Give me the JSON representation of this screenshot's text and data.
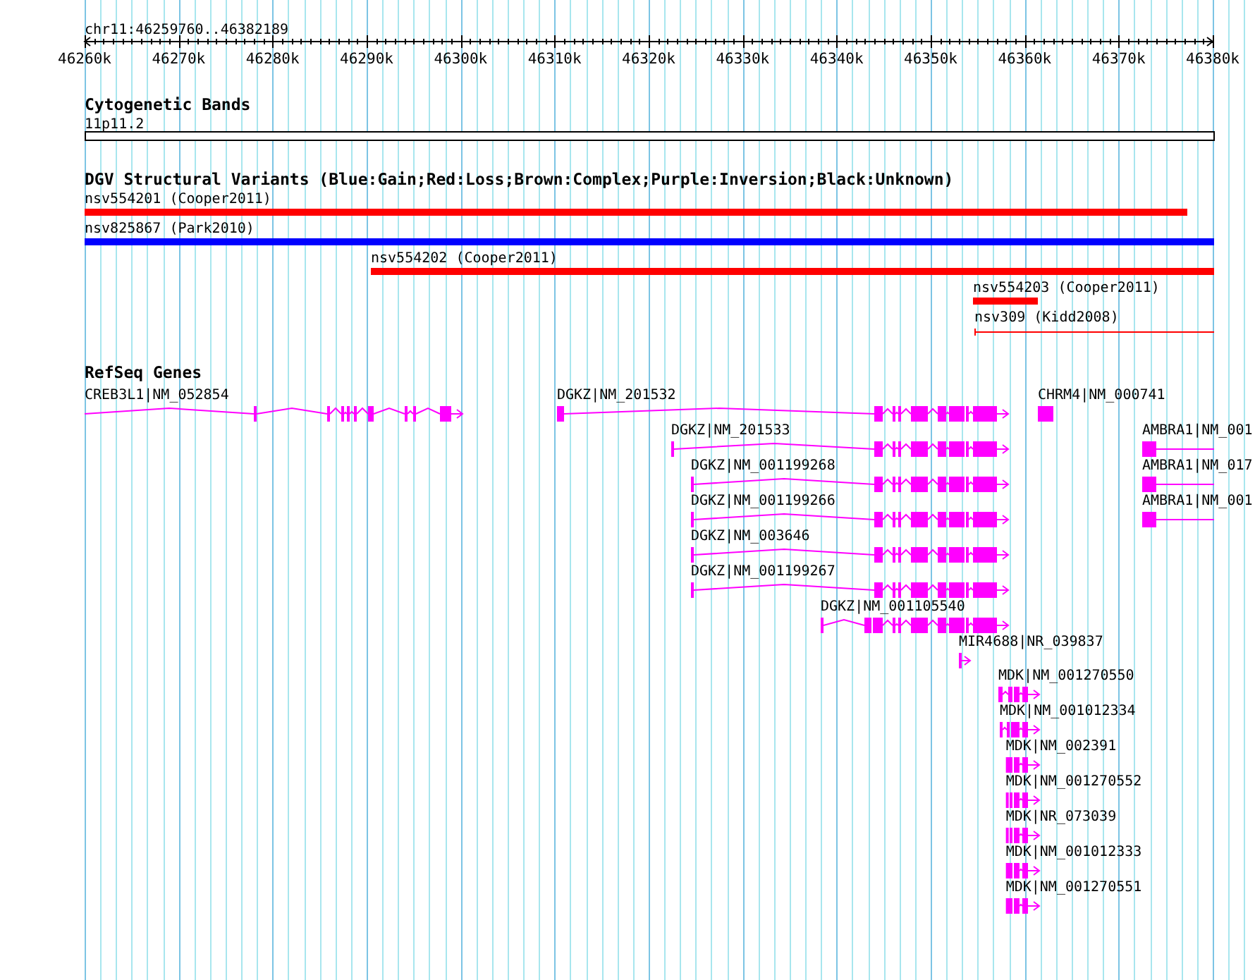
{
  "ruler": {
    "region": "chr11:46259760..46382189",
    "ticks": [
      "46260k",
      "46270k",
      "46280k",
      "46290k",
      "46300k",
      "46310k",
      "46320k",
      "46330k",
      "46340k",
      "46350k",
      "46360k",
      "46370k",
      "46380k"
    ]
  },
  "cytoband": {
    "title": "Cytogenetic Bands",
    "band": "11p11.2"
  },
  "dgv": {
    "title": "DGV Structural Variants (Blue:Gain;Red:Loss;Brown:Complex;Purple:Inversion;Black:Unknown)",
    "features": [
      {
        "label": "nsv554201 (Cooper2011)",
        "kind": "bar",
        "color": "#ff0000"
      },
      {
        "label": "nsv825867 (Park2010)",
        "kind": "bar",
        "color": "#0000ff"
      },
      {
        "label": "nsv554202 (Cooper2011)",
        "kind": "bar",
        "color": "#ff0000"
      },
      {
        "label": "nsv554203 (Cooper2011)",
        "kind": "bar",
        "color": "#ff0000"
      },
      {
        "label": "nsv309 (Kidd2008)",
        "kind": "line",
        "color": "#ff0000"
      }
    ]
  },
  "refseq": {
    "title": "RefSeq Genes",
    "rows": [
      {
        "genes": [
          {
            "label": "CREB3L1|NM_052854",
            "arrow": true
          },
          {
            "label": "DGKZ|NM_201532",
            "arrow": true
          },
          {
            "label": "CHRM4|NM_000741",
            "arrow": false
          }
        ]
      },
      {
        "genes": [
          {
            "label": "DGKZ|NM_201533",
            "arrow": true
          },
          {
            "label": "AMBRA1|NM_001",
            "arrow": false
          }
        ]
      },
      {
        "genes": [
          {
            "label": "DGKZ|NM_001199268",
            "arrow": true
          },
          {
            "label": "AMBRA1|NM_017",
            "arrow": false
          }
        ]
      },
      {
        "genes": [
          {
            "label": "DGKZ|NM_001199266",
            "arrow": true
          },
          {
            "label": "AMBRA1|NM_001",
            "arrow": false
          }
        ]
      },
      {
        "genes": [
          {
            "label": "DGKZ|NM_003646",
            "arrow": true
          }
        ]
      },
      {
        "genes": [
          {
            "label": "DGKZ|NM_001199267",
            "arrow": true
          }
        ]
      },
      {
        "genes": [
          {
            "label": "DGKZ|NM_001105540",
            "arrow": true
          }
        ]
      },
      {
        "genes": [
          {
            "label": "MIR4688|NR_039837",
            "arrow": true
          }
        ]
      },
      {
        "genes": [
          {
            "label": "MDK|NM_001270550",
            "arrow": true
          }
        ]
      },
      {
        "genes": [
          {
            "label": "MDK|NM_001012334",
            "arrow": true
          }
        ]
      },
      {
        "genes": [
          {
            "label": "MDK|NM_002391",
            "arrow": true
          }
        ]
      },
      {
        "genes": [
          {
            "label": "MDK|NM_001270552",
            "arrow": true
          }
        ]
      },
      {
        "genes": [
          {
            "label": "MDK|NR_073039",
            "arrow": true
          }
        ]
      },
      {
        "genes": [
          {
            "label": "MDK|NM_001012333",
            "arrow": true
          }
        ]
      },
      {
        "genes": [
          {
            "label": "MDK|NM_001270551",
            "arrow": true
          }
        ]
      }
    ]
  }
}
